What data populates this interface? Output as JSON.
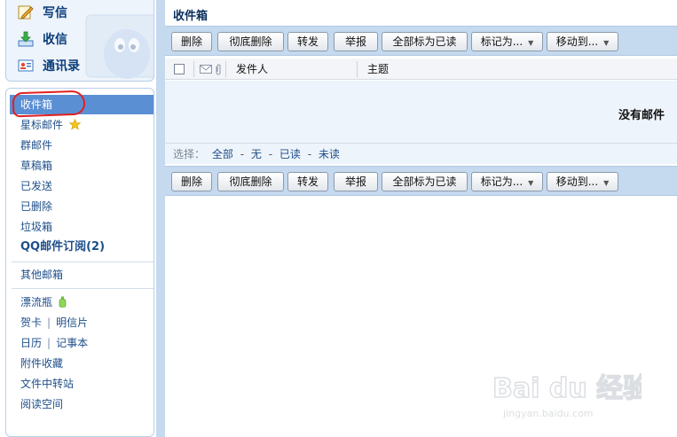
{
  "sidebar": {
    "actions": [
      {
        "label": "写信",
        "icon": "compose-pencil-icon"
      },
      {
        "label": "收信",
        "icon": "receive-download-icon"
      },
      {
        "label": "通讯录",
        "icon": "contacts-card-icon"
      }
    ],
    "folders": [
      {
        "label": "收件箱",
        "active": true
      },
      {
        "label": "星标邮件",
        "icon": "star-icon"
      },
      {
        "label": "群邮件"
      },
      {
        "label": "草稿箱"
      },
      {
        "label": "已发送"
      },
      {
        "label": "已删除"
      },
      {
        "label": "垃圾箱"
      },
      {
        "label": "QQ邮件订阅(2)"
      }
    ],
    "other_mailboxes": "其他邮箱",
    "apps": {
      "drift_bottle": "漂流瓶",
      "card": "贺卡",
      "postcard": "明信片",
      "calendar": "日历",
      "notes": "记事本",
      "attachments": "附件收藏",
      "file_transfer": "文件中转站",
      "reading": "阅读空间"
    }
  },
  "main": {
    "title": "收件箱",
    "toolbar": {
      "delete": "删除",
      "delete_permanent": "彻底删除",
      "forward": "转发",
      "report": "举报",
      "mark_all_read": "全部标为已读",
      "mark_as": "标记为...",
      "move_to": "移动到..."
    },
    "columns": {
      "sender": "发件人",
      "subject": "主题"
    },
    "empty_message": "没有邮件",
    "select": {
      "lead": "选择：",
      "all": "全部",
      "none": "无",
      "read": "已读",
      "unread": "未读"
    }
  },
  "watermark": {
    "brand": "Bai du 经验",
    "url": "jingyan.baidu.com"
  },
  "colors": {
    "accent_blue": "#5b8fd4",
    "toolbar_bg": "#c5d9ef",
    "link_blue": "#1e4f8a",
    "highlight_red": "#e21f1f"
  }
}
